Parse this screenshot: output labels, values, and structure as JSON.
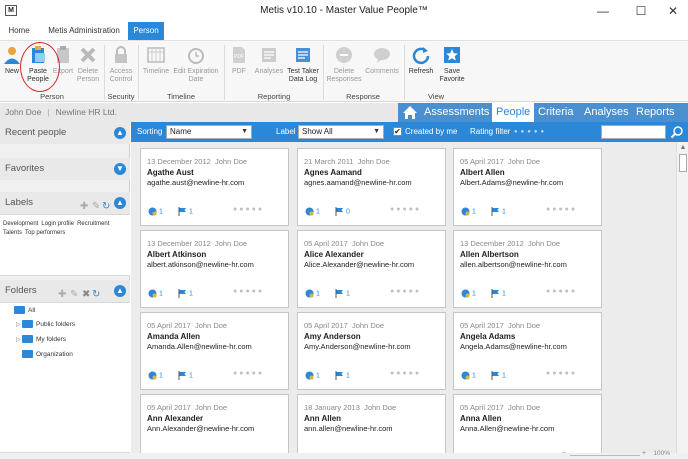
{
  "window": {
    "app_icon": "M",
    "title": "Metis v10.10 - Master Value People™",
    "minimize": "—",
    "maximize": "☐",
    "close": "✕"
  },
  "ribbon_tabs": [
    {
      "label": "Home"
    },
    {
      "label": "Metis Administration"
    },
    {
      "label": "Person"
    }
  ],
  "ribbon": {
    "buttons": {
      "new": "New",
      "paste_people_1": "Paste",
      "paste_people_2": "People",
      "export": "Export",
      "delete_person_1": "Delete",
      "delete_person_2": "Person",
      "access_control_1": "Access",
      "access_control_2": "Control",
      "timeline": "Timeline",
      "edit_expiration_1": "Edit Expiration",
      "edit_expiration_2": "Date",
      "pdf": "PDF",
      "analyses": "Analyses",
      "test_taker_1": "Test Taker",
      "test_taker_2": "Data Log",
      "delete_responses_1": "Delete",
      "delete_responses_2": "Responses",
      "comments": "Comments",
      "refresh": "Refresh",
      "save_favorite_1": "Save",
      "save_favorite_2": "Favorite"
    },
    "groups": {
      "person": "Person",
      "security": "Security",
      "timeline": "Timeline",
      "reporting": "Reporting",
      "response": "Response",
      "view": "View"
    }
  },
  "nav": {
    "user": "John Doe",
    "org": "Newline HR Ltd.",
    "tabs": [
      "Assessments",
      "People",
      "Criteria",
      "Analyses",
      "Reports"
    ]
  },
  "sidebar": {
    "recent_people": "Recent people",
    "favorites": "Favorites",
    "labels": "Labels",
    "label_items": [
      "Development",
      "Login profile",
      "Recruitment",
      "Talents",
      "Top performers"
    ],
    "folders": "Folders",
    "folder_tree": [
      "All",
      "Public folders",
      "My folders",
      "Organization"
    ]
  },
  "toolbar": {
    "sorting_label": "Sorting",
    "sorting_value": "Name",
    "label_label": "Label",
    "label_value": "Show All",
    "created_by_me": "Created by me",
    "rating_filter": "Rating filter"
  },
  "cards": [
    {
      "date": "13 December 2012",
      "author": "John Doe",
      "name": "Agathe Aust",
      "email": "agathe.aust@newline-hr.com",
      "tests": "1",
      "reports": "1"
    },
    {
      "date": "21 March 2011",
      "author": "John Doe",
      "name": "Agnes Aamand",
      "email": "agnes.aamand@newline-hr.com",
      "tests": "1",
      "reports": "0"
    },
    {
      "date": "05 April 2017",
      "author": "John Doe",
      "name": "Albert Allen",
      "email": "Albert.Adams@newline-hr.com",
      "tests": "1",
      "reports": "1"
    },
    {
      "date": "13 December 2012",
      "author": "John Doe",
      "name": "Albert Atkinson",
      "email": "albert.atkinson@newline-hr.com",
      "tests": "1",
      "reports": "1"
    },
    {
      "date": "05 April 2017",
      "author": "John Doe",
      "name": "Alice Alexander",
      "email": "Alice.Alexander@newline-hr.com",
      "tests": "1",
      "reports": "1"
    },
    {
      "date": "13 December 2012",
      "author": "John Doe",
      "name": "Allen Albertson",
      "email": "allen.albertson@newline-hr.com",
      "tests": "1",
      "reports": "1"
    },
    {
      "date": "05 April 2017",
      "author": "John Doe",
      "name": "Amanda Allen",
      "email": "Amanda.Allen@newline-hr.com",
      "tests": "1",
      "reports": "1"
    },
    {
      "date": "05 April 2017",
      "author": "John Doe",
      "name": "Amy Anderson",
      "email": "Amy.Anderson@newline-hr.com",
      "tests": "1",
      "reports": "1"
    },
    {
      "date": "05 April 2017",
      "author": "John Doe",
      "name": "Angela Adams",
      "email": "Angela.Adams@newline-hr.com",
      "tests": "1",
      "reports": "1"
    },
    {
      "date": "05 April 2017",
      "author": "John Doe",
      "name": "Ann Alexander",
      "email": "Ann.Alexander@newline-hr.com",
      "tests": "",
      "reports": ""
    },
    {
      "date": "18 January 2013",
      "author": "John Doe",
      "name": "Ann Allen",
      "email": "ann.allen@newline-hr.com",
      "tests": "",
      "reports": ""
    },
    {
      "date": "05 April 2017",
      "author": "John Doe",
      "name": "Anna Allen",
      "email": "Anna.Allen@newline-hr.com",
      "tests": "",
      "reports": ""
    }
  ],
  "statusbar": {
    "zoom": "100%",
    "zoom_minus": "−",
    "zoom_plus": "+"
  },
  "colors": {
    "accent": "#2b88d8",
    "nav_blue": "#4a8fd0",
    "highlight": "#d9262c"
  },
  "icons": [
    "new-person-icon",
    "paste-people-icon",
    "export-icon",
    "delete-person-icon",
    "lock-icon",
    "timeline-icon",
    "alarm-clock-icon",
    "pdf-icon",
    "analyses-icon",
    "data-log-icon",
    "delete-responses-icon",
    "comments-icon",
    "refresh-icon",
    "star-icon",
    "home-icon",
    "search-icon",
    "folder-icon",
    "test-icon",
    "flag-icon"
  ]
}
